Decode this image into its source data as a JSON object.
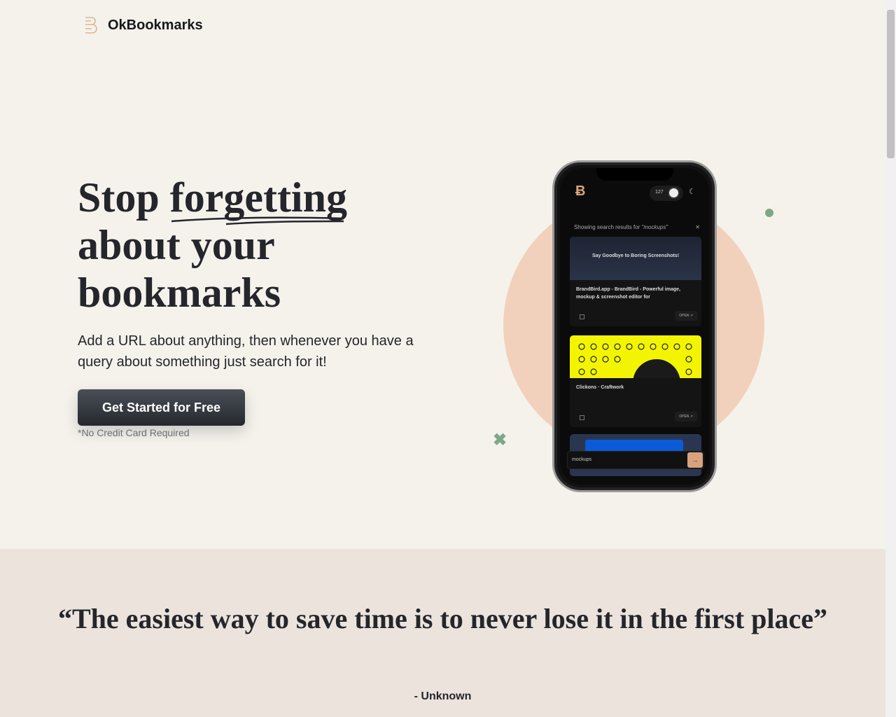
{
  "brand": {
    "name": "OkBookmarks",
    "accent": "#d9a27e"
  },
  "hero": {
    "title_pre": "Stop ",
    "title_underlined": "forgetting",
    "title_post": "about your bookmarks",
    "subtitle": "Add a URL about anything, then whenever you have a query about something just search for it!",
    "cta": "Get Started for Free",
    "note": "*No Credit Card Required"
  },
  "phone": {
    "count": "127",
    "results_label": "Showing search results for ",
    "query_shown": "\"mockups\"",
    "cards": [
      {
        "thumb_brand": "BrandBird",
        "thumb_text": "Say Goodbye to Boring Screenshots!",
        "title": "BrandBird.app - BrandBird - Powerful image, mockup & screenshot editor for",
        "open": "OPEN"
      },
      {
        "title": "Clickons · Craftwork",
        "open": "OPEN"
      }
    ],
    "search_value": "mockups"
  },
  "quote": {
    "text": "“The easiest way to save time is to never lose it in the first place”",
    "author": "- Unknown"
  }
}
